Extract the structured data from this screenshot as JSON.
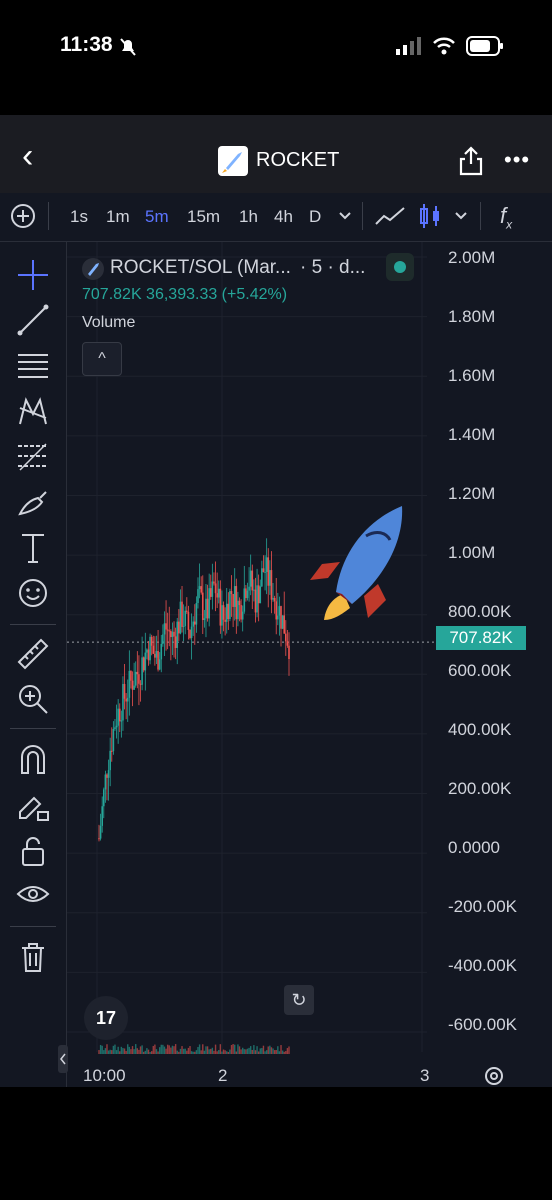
{
  "status_bar": {
    "time": "11:38"
  },
  "header": {
    "back_glyph": "‹",
    "title": "ROCKET",
    "more_glyph": "•••"
  },
  "toolbar": {
    "timeframes": [
      "1s",
      "1m",
      "5m",
      "15m",
      "1h",
      "4h",
      "D"
    ],
    "active_timeframe": "5m",
    "fx_label": "f",
    "fx_sub": "x"
  },
  "legend": {
    "pair": "ROCKET/SOL (Mar...",
    "interval": "· 5 · d...",
    "values": "707.82K  36,393.33 (+5.42%)",
    "volume_label": "Volume",
    "collapse_glyph": "^"
  },
  "price_axis": {
    "ticks": [
      "2.00M",
      "1.80M",
      "1.60M",
      "1.40M",
      "1.20M",
      "1.00M",
      "800.00K",
      "600.00K",
      "400.00K",
      "200.00K",
      "0.0000",
      "-200.00K",
      "-400.00K",
      "-600.00K"
    ],
    "last_price": "707.82K"
  },
  "time_axis": {
    "ticks": [
      "10:00",
      "2",
      "3"
    ]
  },
  "chart_data": {
    "type": "candlestick",
    "x_ticks": [
      "10:00",
      "2",
      "3"
    ],
    "y_ticks": [
      "2.00M",
      "1.80M",
      "1.60M",
      "1.40M",
      "1.20M",
      "1.00M",
      "800.00K",
      "600.00K",
      "400.00K",
      "200.00K",
      "0.0000",
      "-200.00K",
      "-400.00K",
      "-600.00K"
    ],
    "ylim": [
      -600000,
      2000000
    ],
    "last_price": 707820,
    "path_values": [
      50000,
      300000,
      450000,
      520000,
      580000,
      620000,
      700000,
      650000,
      760000,
      720000,
      800000,
      740000,
      860000,
      800000,
      900000,
      780000,
      880000,
      820000,
      930000,
      850000,
      960000,
      880000,
      800000,
      707820
    ],
    "colors": {
      "up": "#26a69a",
      "down": "#ef5350"
    }
  },
  "tv_logo_text": "17",
  "reset_glyph": "↻",
  "colors": {
    "background": "#131722",
    "accent": "#5b74ff",
    "up": "#26a69a",
    "down": "#ef5350"
  },
  "icons": [
    "back-icon",
    "share-icon",
    "more-icon",
    "plus-circle-icon",
    "chevron-down-icon",
    "line-chart-icon",
    "candles-icon",
    "fx-icon",
    "crosshair-icon",
    "trendline-icon",
    "horizontal-lines-icon",
    "pattern-icon",
    "fib-icon",
    "brush-icon",
    "text-icon",
    "emoji-icon",
    "ruler-icon",
    "zoom-icon",
    "magnet-icon",
    "lock-edit-icon",
    "lock-icon",
    "eye-icon",
    "trash-icon",
    "rocket-icon",
    "settings-icon"
  ]
}
